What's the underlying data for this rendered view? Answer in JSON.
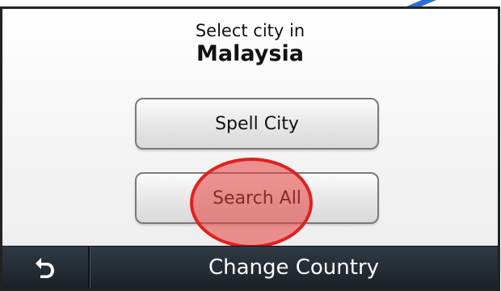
{
  "header": {
    "line1": "Select city in",
    "line2": "Malaysia"
  },
  "buttons": {
    "spell_city": "Spell City",
    "search_all": "Search All"
  },
  "bottom_bar": {
    "back_icon": "back-arrow-icon",
    "title": "Change Country"
  },
  "colors": {
    "highlight": "#e0201f",
    "bar": "#1f262d",
    "stylus": "#2f6ed1"
  }
}
